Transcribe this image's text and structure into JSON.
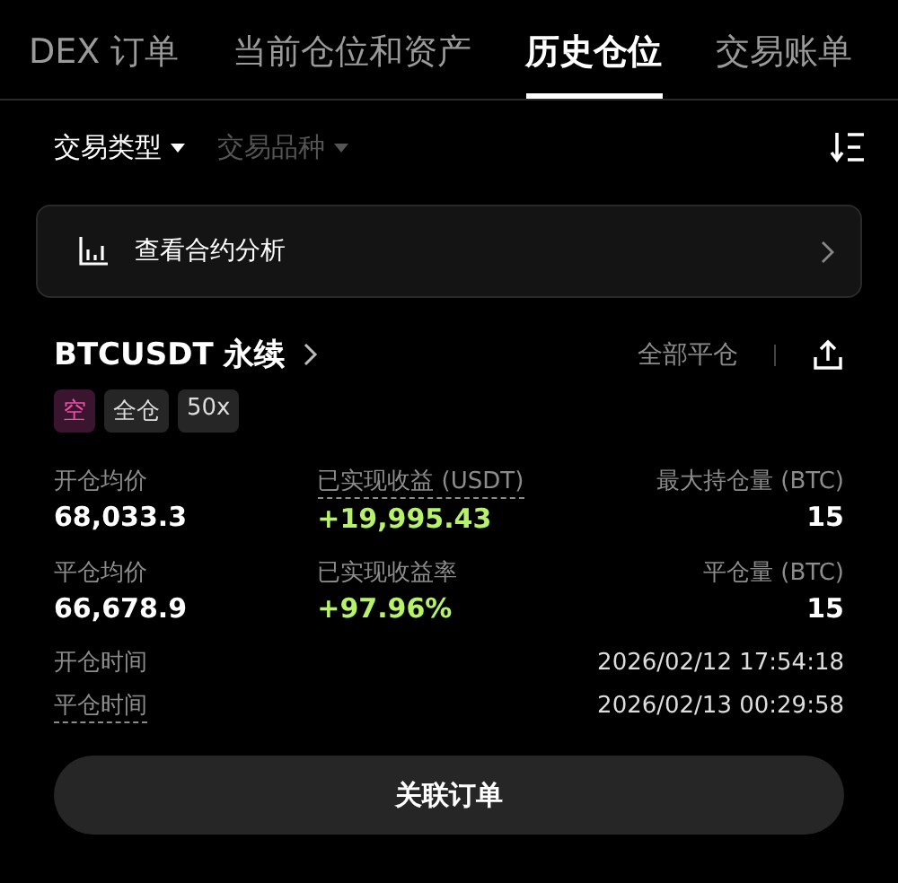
{
  "tabs": [
    {
      "label": "DEX 订单",
      "selected": false
    },
    {
      "label": "当前仓位和资产",
      "selected": false
    },
    {
      "label": "历史仓位",
      "selected": true
    },
    {
      "label": "交易账单",
      "selected": false
    }
  ],
  "filters": [
    {
      "label": "交易类型",
      "active": true
    },
    {
      "label": "交易品种",
      "active": false
    }
  ],
  "analysis_card": {
    "label": "查看合约分析"
  },
  "position": {
    "symbol": "BTCUSDT 永续",
    "close_all": "全部平仓",
    "tags": [
      {
        "label": "空",
        "kind": "short"
      },
      {
        "label": "全仓",
        "kind": "plain"
      },
      {
        "label": "50x",
        "kind": "plain"
      }
    ],
    "stats": [
      {
        "label": "开仓均价",
        "value": "68,033.3",
        "kind": "plain",
        "dashed": false
      },
      {
        "label": "已实现收益 (USDT)",
        "value": "+19,995.43",
        "kind": "profit",
        "dashed": true
      },
      {
        "label": "最大持仓量 (BTC)",
        "value": "15",
        "kind": "plain",
        "dashed": false
      },
      {
        "label": "平仓均价",
        "value": "66,678.9",
        "kind": "plain",
        "dashed": false
      },
      {
        "label": "已实现收益率",
        "value": "+97.96%",
        "kind": "profit",
        "dashed": false
      },
      {
        "label": "平仓量 (BTC)",
        "value": "15",
        "kind": "plain",
        "dashed": false
      }
    ],
    "times": [
      {
        "label": "开仓时间",
        "value": "2026/02/12 17:54:18",
        "dashed": false
      },
      {
        "label": "平仓时间",
        "value": "2026/02/13 00:29:58",
        "dashed": true
      }
    ],
    "button": "关联订单"
  }
}
